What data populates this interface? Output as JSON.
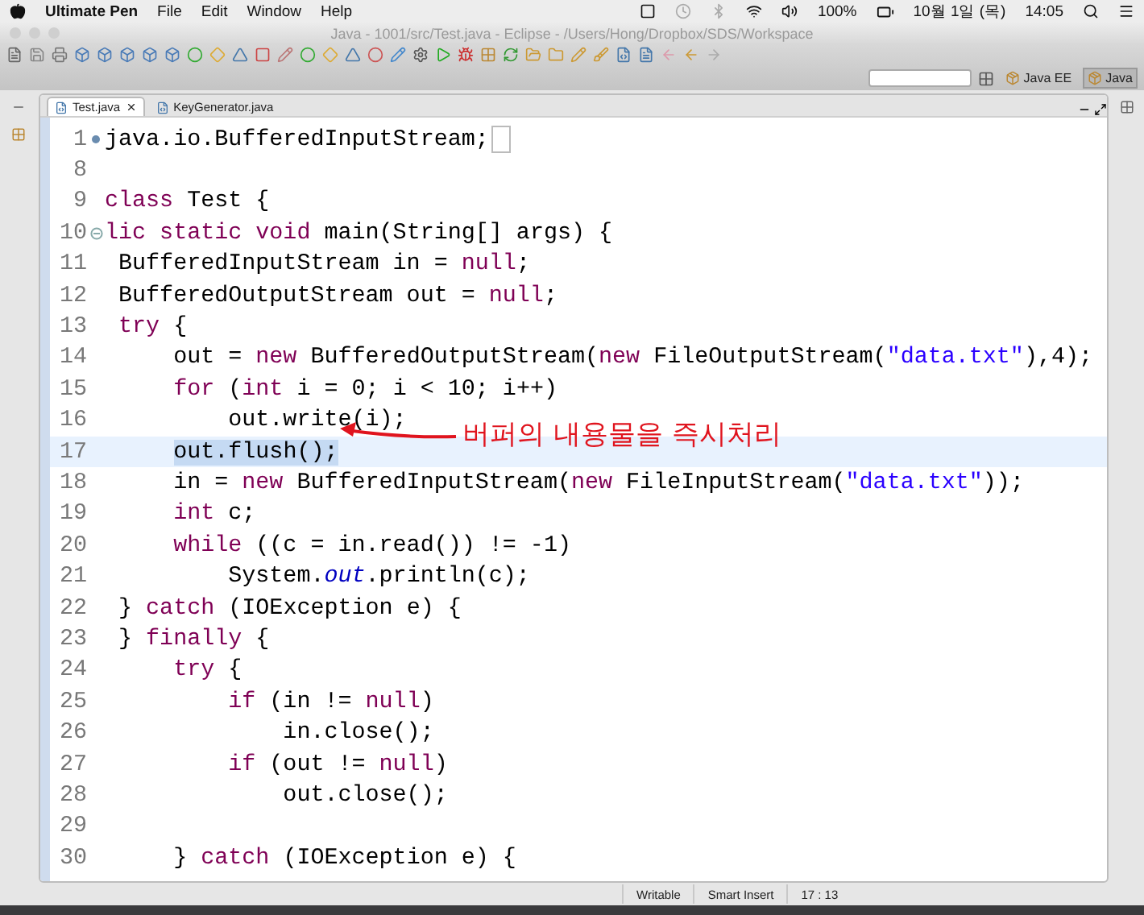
{
  "menubar": {
    "app": "Ultimate Pen",
    "menus": [
      "File",
      "Edit",
      "Window",
      "Help"
    ],
    "status": [
      "100%",
      "10월 1일 (목)",
      "14:05"
    ]
  },
  "window": {
    "title": "Java - 1001/src/Test.java - Eclipse - /Users/Hong/Dropbox/SDS/Workspace"
  },
  "perspectives": [
    {
      "label": "Java EE",
      "selected": false
    },
    {
      "label": "Java",
      "selected": true
    }
  ],
  "editor_tabs": [
    {
      "label": "Test.java",
      "selected": true
    },
    {
      "label": "KeyGenerator.java",
      "selected": false
    }
  ],
  "code_lines": [
    {
      "number": "1",
      "current": false,
      "collapsed": true,
      "segments": [
        {
          "text": "java.io.BufferedInputStream;",
          "kind": "plain"
        }
      ]
    },
    {
      "number": "8",
      "current": false
    },
    {
      "number": "9",
      "current": false,
      "segments": [
        {
          "text": "class",
          "kind": "keyword"
        },
        {
          "text": " Test {",
          "kind": "plain"
        }
      ]
    },
    {
      "number": "10",
      "current": false,
      "collapsed": false,
      "segments": [
        {
          "text": "lic static void",
          "kind": "keyword"
        },
        {
          "text": " main(String[] args) {",
          "kind": "plain"
        }
      ]
    },
    {
      "number": "11",
      "current": false,
      "segments": [
        {
          "text": " BufferedInputStream in = ",
          "kind": "plain"
        },
        {
          "text": "null",
          "kind": "keyword"
        },
        {
          "text": ";",
          "kind": "plain"
        }
      ]
    },
    {
      "number": "12",
      "current": false,
      "segments": [
        {
          "text": " BufferedOutputStream out = ",
          "kind": "plain"
        },
        {
          "text": "null",
          "kind": "keyword"
        },
        {
          "text": ";",
          "kind": "plain"
        }
      ]
    },
    {
      "number": "13",
      "current": false,
      "segments": [
        {
          "text": " try",
          "kind": "keyword"
        },
        {
          "text": " {",
          "kind": "plain"
        }
      ]
    },
    {
      "number": "14",
      "current": false,
      "segments": [
        {
          "text": "     out = ",
          "kind": "plain"
        },
        {
          "text": "new",
          "kind": "keyword"
        },
        {
          "text": " BufferedOutputStream(",
          "kind": "plain"
        },
        {
          "text": "new",
          "kind": "keyword"
        },
        {
          "text": " FileOutputStream(",
          "kind": "plain"
        },
        {
          "text": "\"data.txt\"",
          "kind": "string"
        },
        {
          "text": "),4);",
          "kind": "plain"
        }
      ]
    },
    {
      "number": "15",
      "current": false,
      "segments": [
        {
          "text": "     for",
          "kind": "keyword"
        },
        {
          "text": " (",
          "kind": "plain"
        },
        {
          "text": "int",
          "kind": "keyword"
        },
        {
          "text": " i = 0; i < 10; i++)",
          "kind": "plain"
        }
      ]
    },
    {
      "number": "16",
      "current": false,
      "segments": [
        {
          "text": "         out.write(i);",
          "kind": "plain"
        }
      ]
    },
    {
      "number": "17",
      "current": true,
      "segments": [
        {
          "text": "     out.flush();",
          "kind": "selected"
        }
      ]
    },
    {
      "number": "18",
      "current": false,
      "segments": [
        {
          "text": "     in = ",
          "kind": "plain"
        },
        {
          "text": "new",
          "kind": "keyword"
        },
        {
          "text": " BufferedInputStream(",
          "kind": "plain"
        },
        {
          "text": "new",
          "kind": "keyword"
        },
        {
          "text": " FileInputStream(",
          "kind": "plain"
        },
        {
          "text": "\"data.txt\"",
          "kind": "string"
        },
        {
          "text": "));",
          "kind": "plain"
        }
      ]
    },
    {
      "number": "19",
      "current": false,
      "segments": [
        {
          "text": "     int",
          "kind": "keyword"
        },
        {
          "text": " c;",
          "kind": "plain"
        }
      ]
    },
    {
      "number": "20",
      "current": false,
      "segments": [
        {
          "text": "     while",
          "kind": "keyword"
        },
        {
          "text": " ((c = in.read()) != -1)",
          "kind": "plain"
        }
      ]
    },
    {
      "number": "21",
      "current": false,
      "segments": [
        {
          "text": "         System.",
          "kind": "plain"
        },
        {
          "text": "out",
          "kind": "field"
        },
        {
          "text": ".println(c);",
          "kind": "plain"
        }
      ]
    },
    {
      "number": "22",
      "current": false,
      "segments": [
        {
          "text": " } ",
          "kind": "plain"
        },
        {
          "text": "catch",
          "kind": "keyword"
        },
        {
          "text": " (IOException e) {",
          "kind": "plain"
        }
      ]
    },
    {
      "number": "23",
      "current": false,
      "segments": [
        {
          "text": " } ",
          "kind": "plain"
        },
        {
          "text": "finally",
          "kind": "keyword"
        },
        {
          "text": " {",
          "kind": "plain"
        }
      ]
    },
    {
      "number": "24",
      "current": false,
      "segments": [
        {
          "text": "     try",
          "kind": "keyword"
        },
        {
          "text": " {",
          "kind": "plain"
        }
      ]
    },
    {
      "number": "25",
      "current": false,
      "segments": [
        {
          "text": "         if",
          "kind": "keyword"
        },
        {
          "text": " (in != ",
          "kind": "plain"
        },
        {
          "text": "null",
          "kind": "keyword"
        },
        {
          "text": ")",
          "kind": "plain"
        }
      ]
    },
    {
      "number": "26",
      "current": false,
      "segments": [
        {
          "text": "             in.close();",
          "kind": "plain"
        }
      ]
    },
    {
      "number": "27",
      "current": false,
      "segments": [
        {
          "text": "         if",
          "kind": "keyword"
        },
        {
          "text": " (out != ",
          "kind": "plain"
        },
        {
          "text": "null",
          "kind": "keyword"
        },
        {
          "text": ")",
          "kind": "plain"
        }
      ]
    },
    {
      "number": "28",
      "current": false,
      "segments": [
        {
          "text": "             out.close();",
          "kind": "plain"
        }
      ]
    },
    {
      "number": "29",
      "current": false
    },
    {
      "number": "30",
      "current": false,
      "segments": [
        {
          "text": "     } ",
          "kind": "plain"
        },
        {
          "text": "catch",
          "kind": "keyword"
        },
        {
          "text": " (IOException e) {",
          "kind": "plain"
        }
      ]
    }
  ],
  "annotation": {
    "text": "버퍼의 내용물을 즉시처리",
    "color": "#e0141e"
  },
  "status_bar": [
    "Writable",
    "Smart Insert",
    "17 : 13"
  ]
}
